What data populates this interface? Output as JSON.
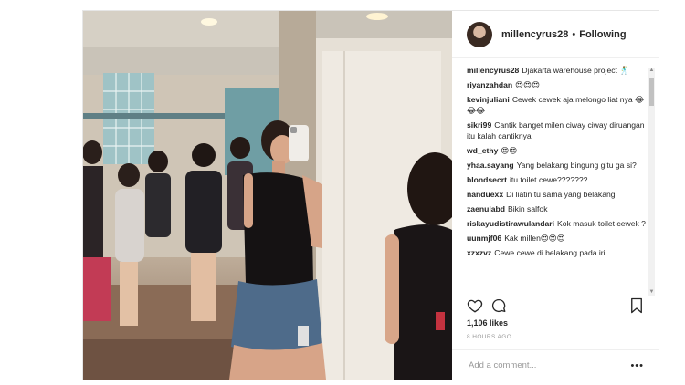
{
  "post": {
    "username": "millencyrus28",
    "separator": "•",
    "follow_status": "Following",
    "comments": [
      {
        "user": "millencyrus28",
        "text": "Djakarta warehouse project 🕺"
      },
      {
        "user": "riyanzahdan",
        "text": "😍😍😍"
      },
      {
        "user": "kevinjuliani",
        "text": "Cewek cewek aja melongo liat nya 😂😂😂"
      },
      {
        "user": "sikri99",
        "text": "Cantik banget milen ciway ciway diruangan itu kalah cantiknya"
      },
      {
        "user": "wd_ethy",
        "text": "😍😍"
      },
      {
        "user": "yhaa.sayang",
        "text": "Yang belakang bingung gitu ga si?"
      },
      {
        "user": "blondsecrt",
        "text": "itu toilet cewe???????"
      },
      {
        "user": "nanduexx",
        "text": "Di liatin tu sama yang belakang"
      },
      {
        "user": "zaenulabd",
        "text": "Bikin salfok"
      },
      {
        "user": "riskayudistirawulandari",
        "text": "Kok masuk toilet cewek ?"
      },
      {
        "user": "uunmjf06",
        "text": "Kak millen😍😍😍"
      },
      {
        "user": "xzxzvz",
        "text": "Cewe cewe di belakang pada iri."
      }
    ],
    "likes": "1,106 likes",
    "time": "8 HOURS AGO",
    "comment_placeholder": "Add a comment...",
    "more_label": "•••"
  },
  "icons": {
    "heart": "heart-icon",
    "comment": "comment-icon",
    "bookmark": "bookmark-icon"
  },
  "colors": {
    "text": "#262626",
    "muted": "#999999",
    "border": "#e6e6e6"
  }
}
